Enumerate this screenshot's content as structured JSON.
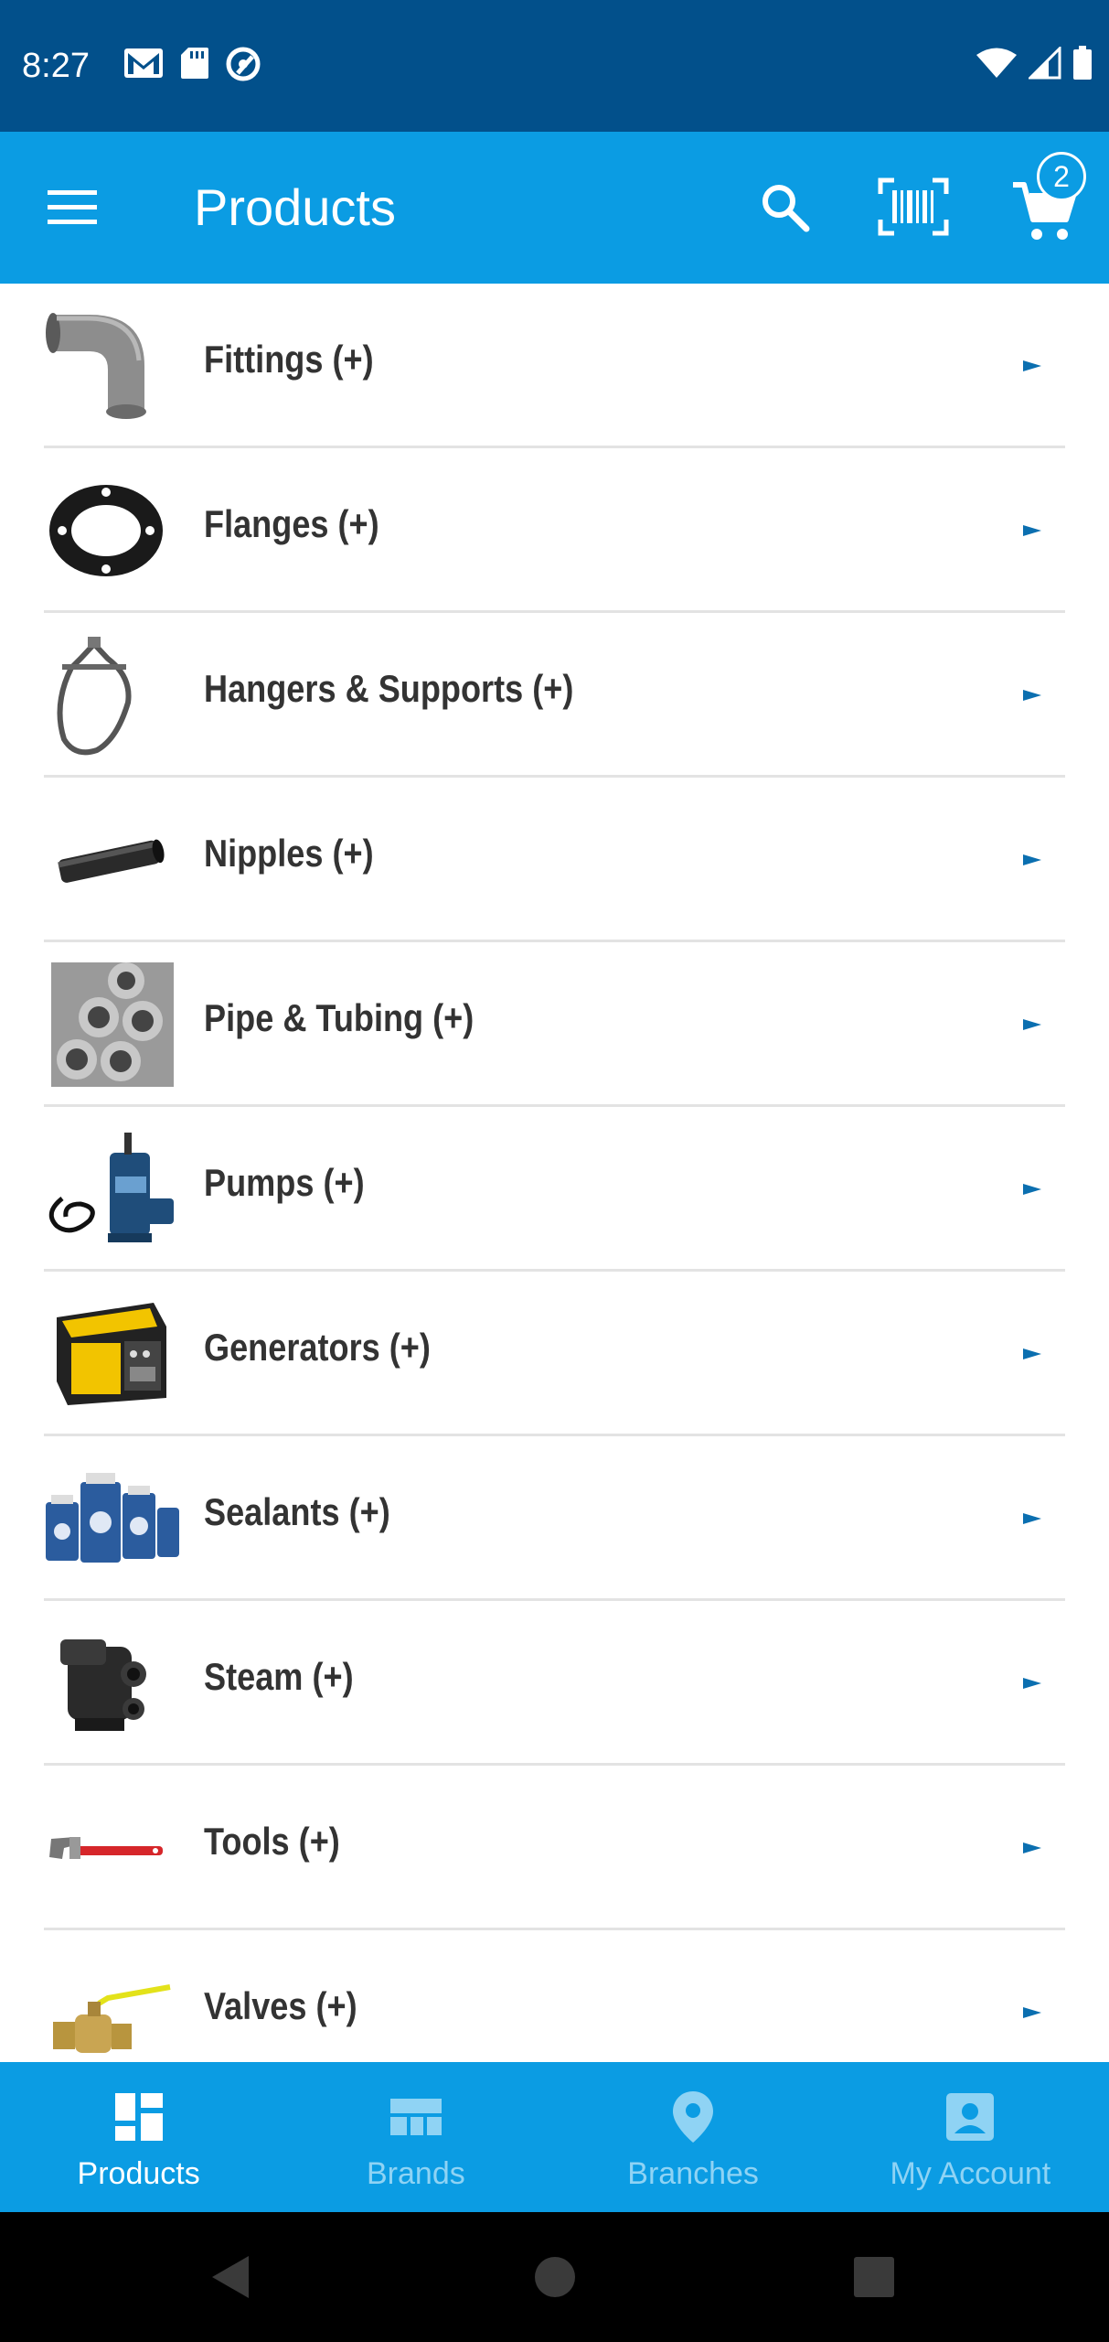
{
  "status_bar": {
    "time": "8:27",
    "left_icons": [
      "gmail-icon",
      "sd-card-icon",
      "sync-off-icon"
    ],
    "right_icons": [
      "wifi-icon",
      "cell-signal-icon",
      "battery-icon"
    ]
  },
  "app_bar": {
    "title": "Products",
    "cart_count": "2",
    "background": "#0b9ce3"
  },
  "categories": [
    {
      "label": "Fittings (+)",
      "icon": "pipe-elbow-icon"
    },
    {
      "label": "Flanges (+)",
      "icon": "flange-icon"
    },
    {
      "label": "Hangers & Supports (+)",
      "icon": "hanger-icon"
    },
    {
      "label": "Nipples (+)",
      "icon": "nipple-icon"
    },
    {
      "label": "Pipe & Tubing (+)",
      "icon": "pipes-icon"
    },
    {
      "label": "Pumps (+)",
      "icon": "pump-icon"
    },
    {
      "label": "Generators (+)",
      "icon": "generator-icon"
    },
    {
      "label": "Sealants (+)",
      "icon": "sealant-cans-icon"
    },
    {
      "label": "Steam (+)",
      "icon": "steam-trap-icon"
    },
    {
      "label": "Tools (+)",
      "icon": "pipe-wrench-icon"
    },
    {
      "label": "Valves (+)",
      "icon": "ball-valve-icon"
    }
  ],
  "bottom_nav": [
    {
      "label": "Products",
      "icon": "dashboard-icon",
      "active": true
    },
    {
      "label": "Brands",
      "icon": "brands-grid-icon",
      "active": false
    },
    {
      "label": "Branches",
      "icon": "location-pin-icon",
      "active": false
    },
    {
      "label": "My Account",
      "icon": "account-box-icon",
      "active": false
    }
  ],
  "colors": {
    "status_bar": "#02508b",
    "primary": "#0b9ce3",
    "arrow": "#0b6fb0",
    "label_text": "#333333"
  }
}
